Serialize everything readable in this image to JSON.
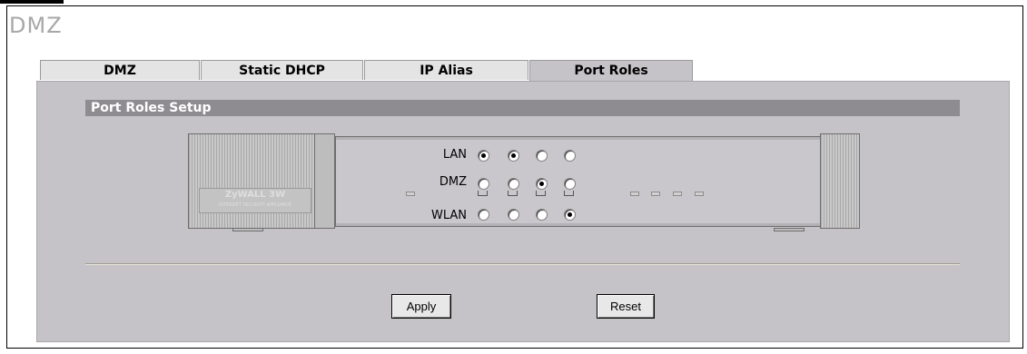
{
  "page": {
    "title": "DMZ"
  },
  "tabs": [
    {
      "label": "DMZ",
      "active": false
    },
    {
      "label": "Static DHCP",
      "active": false
    },
    {
      "label": "IP Alias",
      "active": false
    },
    {
      "label": "Port Roles",
      "active": true
    }
  ],
  "section": {
    "title": "Port Roles Setup"
  },
  "device": {
    "logo_text": "ZyWALL 3W",
    "logo_subtext": "INTERNET SECURITY APPLIANCE"
  },
  "port_roles": {
    "rows": [
      {
        "label": "LAN",
        "selected": [
          true,
          true,
          false,
          false
        ]
      },
      {
        "label": "DMZ",
        "selected": [
          false,
          false,
          true,
          false
        ]
      },
      {
        "label": "WLAN",
        "selected": [
          false,
          false,
          false,
          true
        ]
      }
    ]
  },
  "buttons": {
    "apply_label": "Apply",
    "reset_label": "Reset"
  }
}
